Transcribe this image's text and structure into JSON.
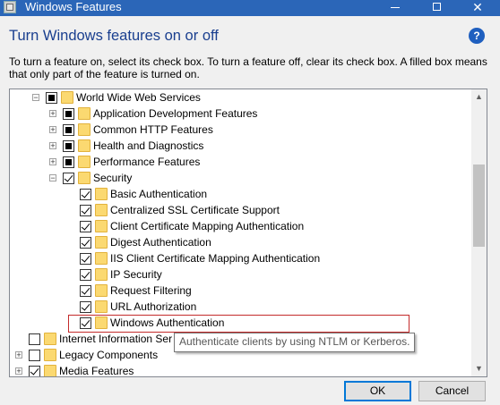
{
  "window": {
    "title": "Windows Features",
    "minimize": "—",
    "maximize": "☐",
    "close": "✕"
  },
  "heading": "Turn Windows features on or off",
  "help_glyph": "?",
  "description": "To turn a feature on, select its check box. To turn a feature off, clear its check box. A filled box means that only part of the feature is turned on.",
  "tree": {
    "items": [
      {
        "label": "World Wide Web Services",
        "state": "partial",
        "expander": "−"
      },
      {
        "label": "Application Development Features",
        "state": "partial",
        "expander": "+"
      },
      {
        "label": "Common HTTP Features",
        "state": "partial",
        "expander": "+"
      },
      {
        "label": "Health and Diagnostics",
        "state": "partial",
        "expander": "+"
      },
      {
        "label": "Performance Features",
        "state": "partial",
        "expander": "+"
      },
      {
        "label": "Security",
        "state": "checked",
        "expander": "−"
      },
      {
        "label": "Basic Authentication",
        "state": "checked"
      },
      {
        "label": "Centralized SSL Certificate Support",
        "state": "checked"
      },
      {
        "label": "Client Certificate Mapping Authentication",
        "state": "checked"
      },
      {
        "label": "Digest Authentication",
        "state": "checked"
      },
      {
        "label": "IIS Client Certificate Mapping Authentication",
        "state": "checked"
      },
      {
        "label": "IP Security",
        "state": "checked"
      },
      {
        "label": "Request Filtering",
        "state": "checked"
      },
      {
        "label": "URL Authorization",
        "state": "checked"
      },
      {
        "label": "Windows Authentication",
        "state": "checked"
      },
      {
        "label": "Internet Information Ser",
        "state": "unchecked"
      },
      {
        "label": "Legacy Components",
        "state": "unchecked",
        "expander": "+"
      },
      {
        "label": "Media Features",
        "state": "checked",
        "expander": "+"
      }
    ]
  },
  "scrollbar": {
    "up": "▲",
    "down": "▼"
  },
  "tooltip": "Authenticate clients by using NTLM or Kerberos.",
  "buttons": {
    "ok": "OK",
    "cancel": "Cancel"
  }
}
